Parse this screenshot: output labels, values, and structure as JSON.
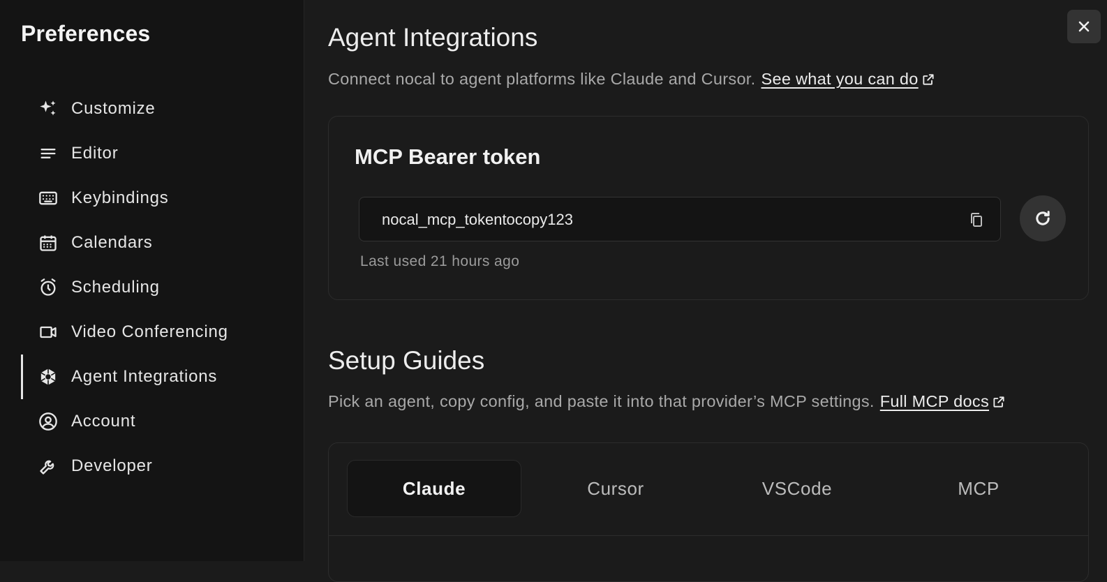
{
  "sidebar": {
    "title": "Preferences",
    "items": [
      {
        "label": "Customize",
        "icon": "sparkles-icon"
      },
      {
        "label": "Editor",
        "icon": "lines-icon"
      },
      {
        "label": "Keybindings",
        "icon": "keyboard-icon"
      },
      {
        "label": "Calendars",
        "icon": "calendar-icon"
      },
      {
        "label": "Scheduling",
        "icon": "alarm-clock-icon"
      },
      {
        "label": "Video Conferencing",
        "icon": "video-camera-icon"
      },
      {
        "label": "Agent Integrations",
        "icon": "agent-hex-icon",
        "active": true
      },
      {
        "label": "Account",
        "icon": "user-circle-icon"
      },
      {
        "label": "Developer",
        "icon": "wrench-icon"
      }
    ]
  },
  "main": {
    "integrations": {
      "title": "Agent Integrations",
      "description": "Connect nocal to agent platforms like Claude and Cursor.",
      "link_label": "See what you can do"
    },
    "token": {
      "title": "MCP Bearer token",
      "value": "nocal_mcp_tokentocopy123",
      "last_used": "Last used 21 hours ago"
    },
    "guides": {
      "title": "Setup Guides",
      "description": "Pick an agent, copy config, and paste it into that provider’s MCP settings.",
      "link_label": "Full MCP docs",
      "tabs": [
        {
          "label": "Claude",
          "active": true
        },
        {
          "label": "Cursor"
        },
        {
          "label": "VSCode"
        },
        {
          "label": "MCP"
        }
      ]
    }
  },
  "colors": {
    "background": "#1b1b1b",
    "sidebar": "#141414",
    "text": "#e9e9e9",
    "muted": "#a9a9a9"
  }
}
